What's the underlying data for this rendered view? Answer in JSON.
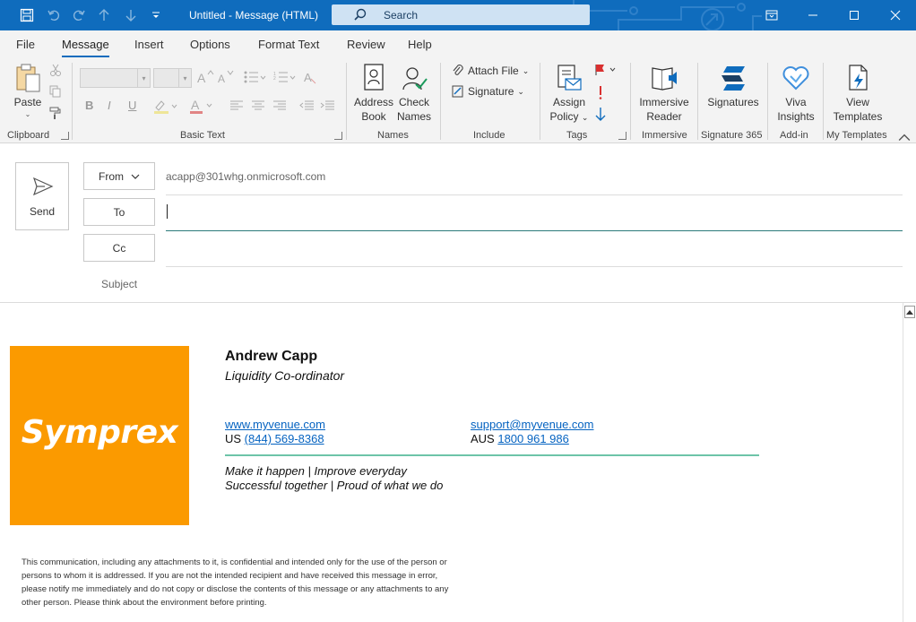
{
  "window": {
    "title": "Untitled  -  Message (HTML)",
    "search_placeholder": "Search"
  },
  "menu": {
    "tabs": [
      "File",
      "Message",
      "Insert",
      "Options",
      "Format Text",
      "Review",
      "Help"
    ],
    "active": "Message"
  },
  "ribbon": {
    "clipboard": {
      "paste": "Paste",
      "label": "Clipboard"
    },
    "basic_text": {
      "label": "Basic Text",
      "bold": "B",
      "italic": "I",
      "underline": "U",
      "font_color": "A"
    },
    "names": {
      "address_book_1": "Address",
      "address_book_2": "Book",
      "check_names_1": "Check",
      "check_names_2": "Names",
      "label": "Names"
    },
    "include": {
      "attach_file": "Attach File",
      "signature": "Signature",
      "label": "Include"
    },
    "tags": {
      "assign_policy_1": "Assign",
      "assign_policy_2": "Policy",
      "label": "Tags"
    },
    "immersive": {
      "btn_1": "Immersive",
      "btn_2": "Reader",
      "label": "Immersive"
    },
    "signature365": {
      "btn": "Signatures",
      "label": "Signature 365"
    },
    "addin": {
      "btn_1": "Viva",
      "btn_2": "Insights",
      "label": "Add-in"
    },
    "templates": {
      "btn_1": "View",
      "btn_2": "Templates",
      "label": "My Templates"
    }
  },
  "compose": {
    "send": "Send",
    "from_label": "From",
    "from_address": "acapp@301whg.onmicrosoft.com",
    "to_label": "To",
    "cc_label": "Cc",
    "subject_label": "Subject"
  },
  "signature": {
    "logo_text": "Symprex",
    "name": "Andrew Capp",
    "role": "Liquidity Co-ordinator",
    "website": "www.myvenue.com",
    "email": "support@myvenue.com",
    "us_prefix": "US ",
    "us_phone": "(844) 569-8368",
    "aus_prefix": "AUS ",
    "aus_phone": "1800 961 986",
    "motto_line1": "Make it happen   |   Improve everyday",
    "motto_line2": "Successful together   |   Proud of what we do",
    "disclaimer": "This communication, including any attachments to it, is confidential and intended only for the use of the person or persons to whom it is addressed. If you are not the intended recipient and have received this message in error, please notify me immediately and do not copy or disclose the contents of this message or any attachments to any other person. Please think about the environment before printing."
  },
  "colors": {
    "titlebar": "#0f6cbd",
    "logo_bg": "#fb9a00",
    "link": "#0563c1",
    "rule": "#6dc4a8"
  }
}
